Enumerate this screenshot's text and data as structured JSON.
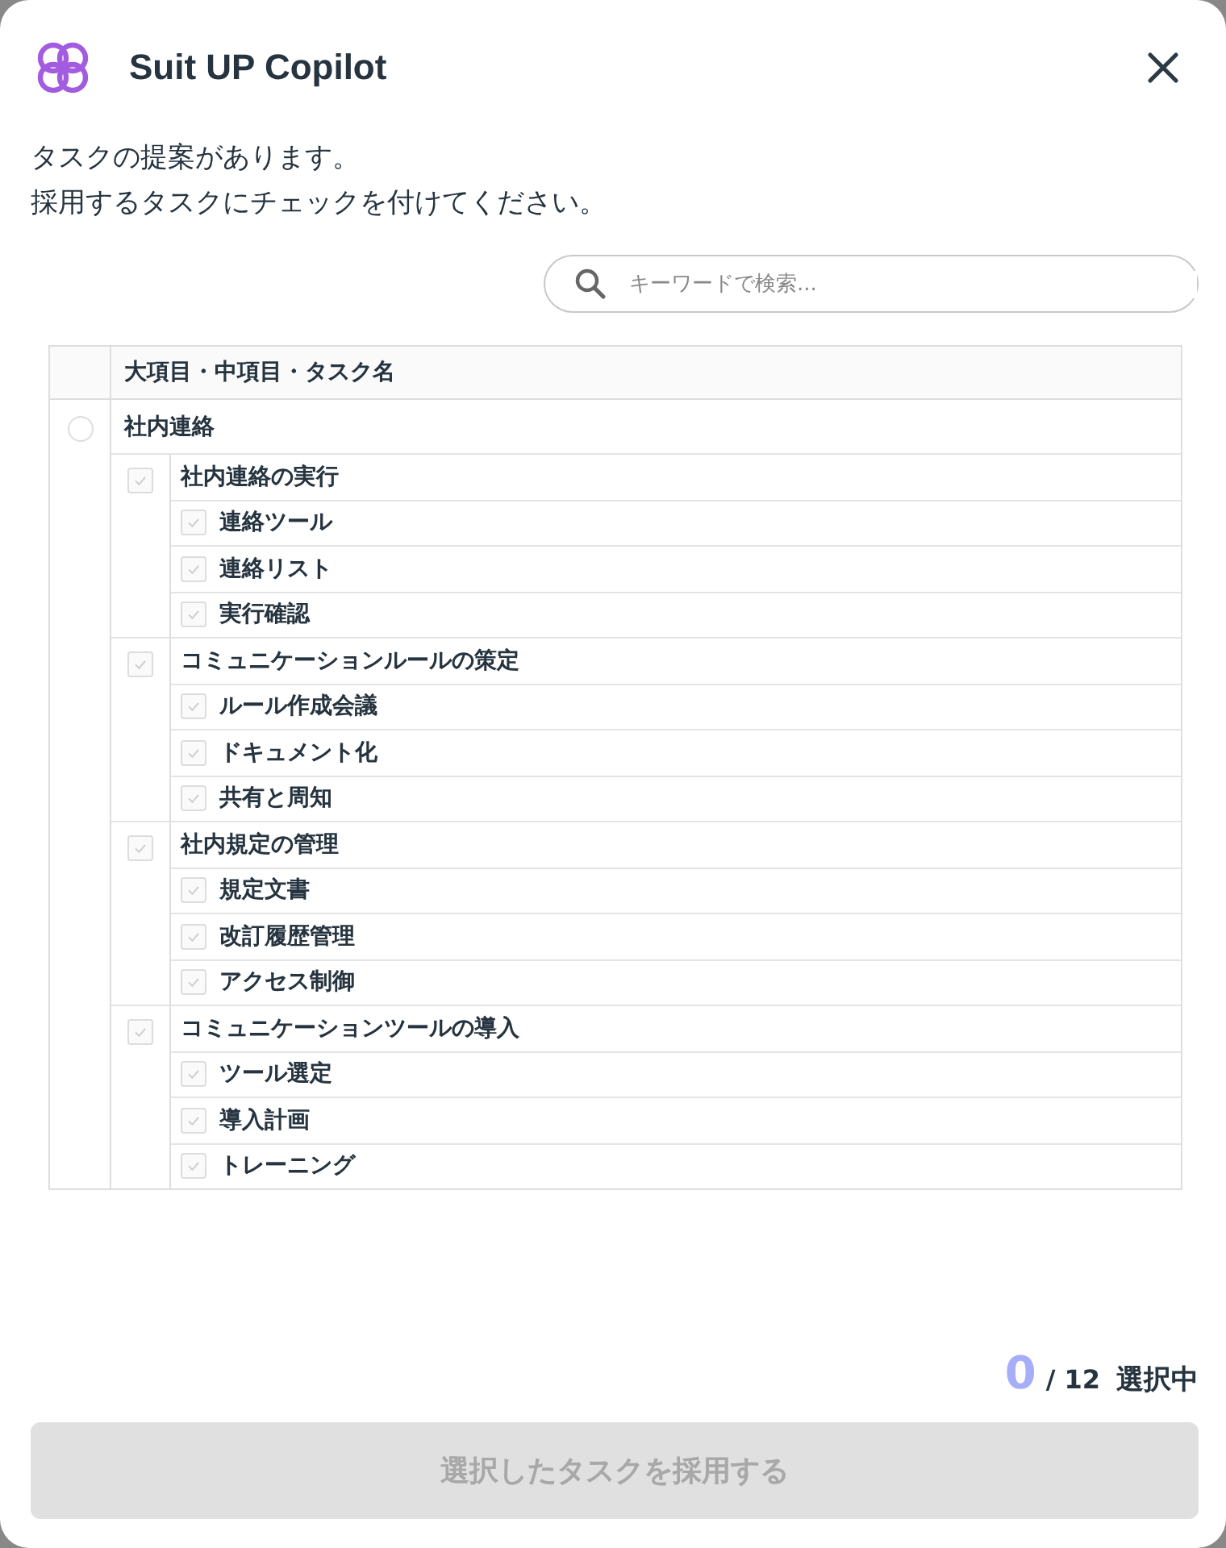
{
  "header": {
    "title": "Suit UP Copilot"
  },
  "message": [
    "タスクの提案があります。",
    "採用するタスクにチェックを付けてください。"
  ],
  "search": {
    "placeholder": "キーワードで検索..."
  },
  "table": {
    "column_header": "大項目・中項目・タスク名",
    "groups": [
      {
        "label": "社内連絡",
        "selected": false,
        "children": [
          {
            "label": "社内連絡の実行",
            "checked": false,
            "disabled": true,
            "children": [
              {
                "label": "連絡ツール",
                "checked": false,
                "disabled": true
              },
              {
                "label": "連絡リスト",
                "checked": false,
                "disabled": true
              },
              {
                "label": "実行確認",
                "checked": false,
                "disabled": true
              }
            ]
          },
          {
            "label": "コミュニケーションルールの策定",
            "checked": false,
            "disabled": true,
            "children": [
              {
                "label": "ルール作成会議",
                "checked": false,
                "disabled": true
              },
              {
                "label": "ドキュメント化",
                "checked": false,
                "disabled": true
              },
              {
                "label": "共有と周知",
                "checked": false,
                "disabled": true
              }
            ]
          },
          {
            "label": "社内規定の管理",
            "checked": false,
            "disabled": true,
            "children": [
              {
                "label": "規定文書",
                "checked": false,
                "disabled": true
              },
              {
                "label": "改訂履歴管理",
                "checked": false,
                "disabled": true
              },
              {
                "label": "アクセス制御",
                "checked": false,
                "disabled": true
              }
            ]
          },
          {
            "label": "コミュニケーションツールの導入",
            "checked": false,
            "disabled": true,
            "children": [
              {
                "label": "ツール選定",
                "checked": false,
                "disabled": true
              },
              {
                "label": "導入計画",
                "checked": false,
                "disabled": true
              },
              {
                "label": "トレーニング",
                "checked": false,
                "disabled": true
              }
            ]
          }
        ]
      }
    ]
  },
  "counter": {
    "selected": "0",
    "total": "/ 12",
    "label": "選択中"
  },
  "submit": {
    "label": "選択したタスクを採用する",
    "disabled": true
  }
}
